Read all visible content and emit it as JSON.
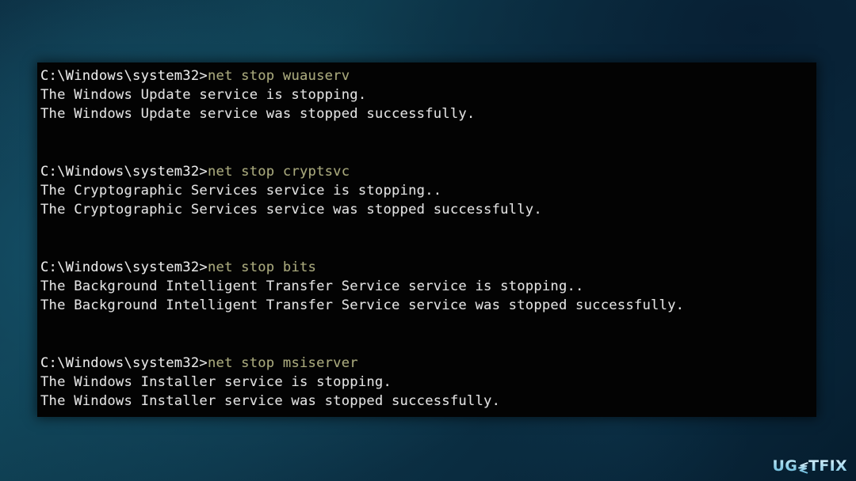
{
  "window": {
    "kind": "windows-command-prompt",
    "background_description": "dark teal to navy blurred gradient backdrop"
  },
  "terminal": {
    "prompt": "C:\\Windows\\system32>",
    "colors": {
      "background": "#030303",
      "output_text": "#e2e2e2",
      "prompt_text": "#eaeaea",
      "command_text": "#a9a97a"
    },
    "blocks": [
      {
        "command": "net stop wuauserv",
        "output": [
          "The Windows Update service is stopping.",
          "The Windows Update service was stopped successfully."
        ]
      },
      {
        "command": "net stop cryptsvc",
        "output": [
          "The Cryptographic Services service is stopping..",
          "The Cryptographic Services service was stopped successfully."
        ]
      },
      {
        "command": "net stop bits",
        "output": [
          "The Background Intelligent Transfer Service service is stopping..",
          "The Background Intelligent Transfer Service service was stopped successfully."
        ]
      },
      {
        "command": "net stop msiserver",
        "output": [
          "The Windows Installer service is stopping.",
          "The Windows Installer service was stopped successfully."
        ]
      }
    ]
  },
  "watermark": {
    "text_start": "UG",
    "glyph": "stylized-e-icon",
    "text_end": "TFIX",
    "full_text": "UGETFIX",
    "color": "#8fd4ea"
  }
}
